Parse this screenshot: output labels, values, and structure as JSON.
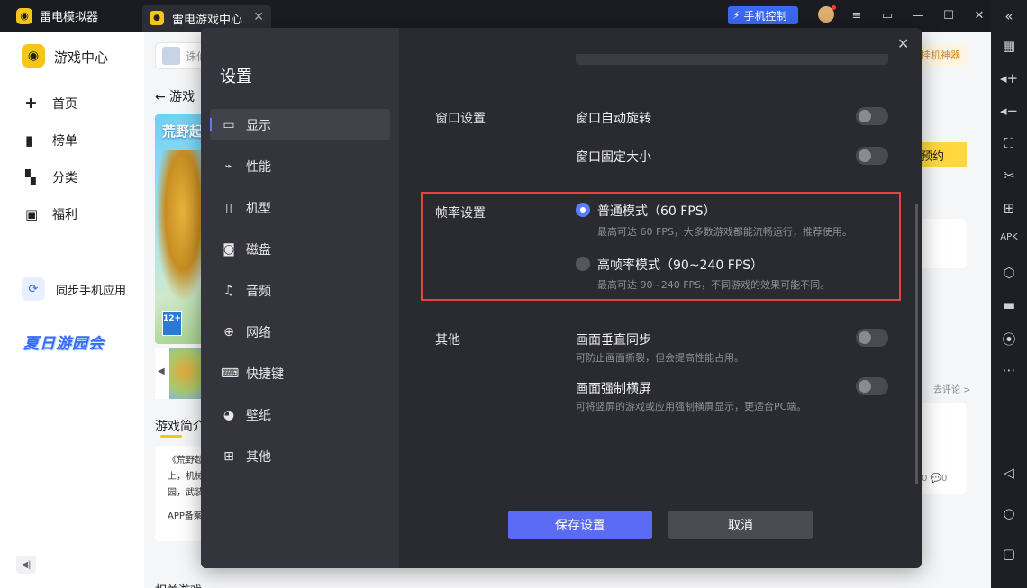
{
  "titlebar": {
    "app_title": "雷电模拟器",
    "tab_label": "雷电游戏中心",
    "tab_close": "✕",
    "phone_control": "手机控制",
    "icons": [
      "avatar",
      "menu-icon",
      "minimize-icon",
      "restore-icon",
      "maximize-icon",
      "close-icon"
    ]
  },
  "rightbar": {
    "icons": [
      "collapse-icon",
      "keyboard-icon",
      "volume-up-icon",
      "volume-down-icon",
      "screenshot-icon",
      "scissors-icon",
      "add-icon",
      "apk-icon",
      "settings-hex-icon",
      "folder-icon",
      "location-icon",
      "more-icon",
      "back-icon",
      "home-icon",
      "recent-icon"
    ]
  },
  "sidebar": {
    "title": "游戏中心",
    "items": [
      {
        "label": "首页"
      },
      {
        "label": "榜单"
      },
      {
        "label": "分类"
      },
      {
        "label": "福利"
      }
    ],
    "sync_label": "同步手机应用",
    "summer_label": "夏日游园会"
  },
  "background": {
    "search_text": "诛仙",
    "back_link": "← 游戏",
    "banner_title": "荒野起",
    "age_badge": "12+",
    "intro_title": "游戏简介",
    "intro_lines": [
      "《荒野起",
      "上，机械",
      "园，武装",
      "",
      "APP备案"
    ],
    "related_title": "相关游戏",
    "hang_tag": "挂机神器",
    "reserve": "预约",
    "review_link": "去评论 >",
    "counts": "0 💬0"
  },
  "modal": {
    "title": "设置",
    "close": "✕",
    "menu": [
      {
        "label": "显示",
        "icon": "monitor-icon",
        "active": true
      },
      {
        "label": "性能",
        "icon": "chart-icon",
        "active": false
      },
      {
        "label": "机型",
        "icon": "phone-model-icon",
        "active": false
      },
      {
        "label": "磁盘",
        "icon": "disk-icon",
        "active": false
      },
      {
        "label": "音频",
        "icon": "audio-icon",
        "active": false
      },
      {
        "label": "网络",
        "icon": "globe-icon",
        "active": false
      },
      {
        "label": "快捷键",
        "icon": "keyboard-icon",
        "active": false
      },
      {
        "label": "壁纸",
        "icon": "palette-icon",
        "active": false
      },
      {
        "label": "其他",
        "icon": "grid-icon",
        "active": false
      }
    ],
    "window": {
      "section": "窗口设置",
      "auto_rotate": "窗口自动旋转",
      "fixed_size": "窗口固定大小"
    },
    "fps": {
      "section": "帧率设置",
      "normal_label": "普通模式（60 FPS）",
      "normal_desc": "最高可达 60 FPS，大多数游戏都能流畅运行，推荐使用。",
      "high_label": "高帧率模式（90~240 FPS）",
      "high_desc": "最高可达 90~240 FPS，不同游戏的效果可能不同。",
      "selected": "normal"
    },
    "other": {
      "section": "其他",
      "vsync_label": "画面垂直同步",
      "vsync_desc": "可防止画面撕裂，但会提高性能占用。",
      "landscape_label": "画面强制横屏",
      "landscape_desc": "可将竖屏的游戏或应用强制横屏显示，更适合PC端。"
    },
    "buttons": {
      "save": "保存设置",
      "cancel": "取消"
    },
    "colors": {
      "accent": "#5b6bf3",
      "highlight_border": "#e8433f"
    }
  }
}
